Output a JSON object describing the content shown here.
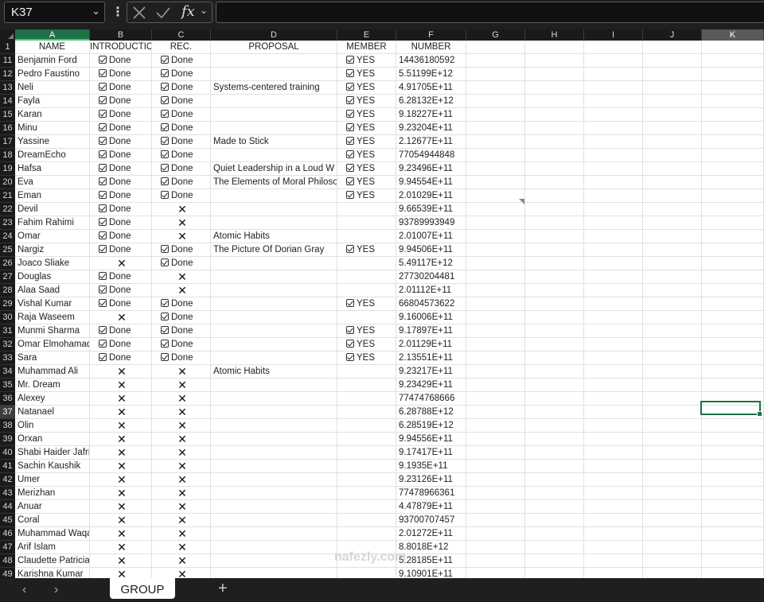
{
  "namebox": {
    "value": "K37"
  },
  "formula": {
    "fx_label": "fx",
    "content": ""
  },
  "columns": [
    {
      "letter": "A",
      "header": "NAME"
    },
    {
      "letter": "B",
      "header": "INTRODUCTION"
    },
    {
      "letter": "C",
      "header": "REC."
    },
    {
      "letter": "D",
      "header": "PROPOSAL"
    },
    {
      "letter": "E",
      "header": "MEMBER"
    },
    {
      "letter": "F",
      "header": "NUMBER"
    },
    {
      "letter": "G",
      "header": ""
    },
    {
      "letter": "H",
      "header": ""
    },
    {
      "letter": "I",
      "header": ""
    },
    {
      "letter": "J",
      "header": ""
    },
    {
      "letter": "K",
      "header": ""
    }
  ],
  "header_row_number": "1",
  "rows": [
    {
      "num": "11",
      "name": "Benjamin Ford",
      "intro": "done",
      "rec": "done",
      "proposal": "",
      "member": "YES",
      "number": "14436180592"
    },
    {
      "num": "12",
      "name": "Pedro Faustino",
      "intro": "done",
      "rec": "done",
      "proposal": "",
      "member": "YES",
      "number": "5.51199E+12"
    },
    {
      "num": "13",
      "name": "Neli",
      "intro": "done",
      "rec": "done",
      "proposal": "Systems-centered training",
      "member": "YES",
      "number": "4.91705E+11"
    },
    {
      "num": "14",
      "name": "Fayla",
      "intro": "done",
      "rec": "done",
      "proposal": "",
      "member": "YES",
      "number": "6.28132E+12"
    },
    {
      "num": "15",
      "name": "Karan",
      "intro": "done",
      "rec": "done",
      "proposal": "",
      "member": "YES",
      "number": "9.18227E+11"
    },
    {
      "num": "16",
      "name": "Minu",
      "intro": "done",
      "rec": "done",
      "proposal": "",
      "member": "YES",
      "number": "9.23204E+11"
    },
    {
      "num": "17",
      "name": "Yassine",
      "intro": "done",
      "rec": "done",
      "proposal": "Made to Stick",
      "member": "YES",
      "number": "2.12677E+11"
    },
    {
      "num": "18",
      "name": "DreamEcho",
      "intro": "done",
      "rec": "done",
      "proposal": "",
      "member": "YES",
      "number": "77054944848"
    },
    {
      "num": "19",
      "name": "Hafsa",
      "intro": "done",
      "rec": "done",
      "proposal": "Quiet Leadership in a Loud W",
      "member": "YES",
      "number": "9.23496E+11"
    },
    {
      "num": "20",
      "name": "Eva",
      "intro": "done",
      "rec": "done",
      "proposal": "The Elements of Moral Philoso",
      "member": "YES",
      "number": "9.94554E+11"
    },
    {
      "num": "21",
      "name": "Eman",
      "intro": "done",
      "rec": "done",
      "proposal": "",
      "member": "YES",
      "number": "2.01029E+11"
    },
    {
      "num": "22",
      "name": "Devil",
      "intro": "done",
      "rec": "x",
      "proposal": "",
      "member": "",
      "number": "9.66539E+11"
    },
    {
      "num": "23",
      "name": "Fahim Rahimi",
      "intro": "done",
      "rec": "x",
      "proposal": "",
      "member": "",
      "number": "93789993949"
    },
    {
      "num": "24",
      "name": "Omar",
      "intro": "done",
      "rec": "x",
      "proposal": "Atomic Habits",
      "member": "",
      "number": "2.01007E+11"
    },
    {
      "num": "25",
      "name": "Nargiz",
      "intro": "done",
      "rec": "done",
      "proposal": "The Picture Of Dorian Gray",
      "member": "YES",
      "number": "9.94506E+11"
    },
    {
      "num": "26",
      "name": "Joaco Sliake",
      "intro": "x",
      "rec": "done",
      "proposal": "",
      "member": "",
      "number": "5.49117E+12"
    },
    {
      "num": "27",
      "name": "Douglas",
      "intro": "done",
      "rec": "x",
      "proposal": "",
      "member": "",
      "number": "27730204481"
    },
    {
      "num": "28",
      "name": "Alaa Saad",
      "intro": "done",
      "rec": "x",
      "proposal": "",
      "member": "",
      "number": "2.01112E+11"
    },
    {
      "num": "29",
      "name": "Vishal Kumar",
      "intro": "done",
      "rec": "done",
      "proposal": "",
      "member": "YES",
      "number": "66804573622"
    },
    {
      "num": "30",
      "name": "Raja Waseem",
      "intro": "x",
      "rec": "done",
      "proposal": "",
      "member": "",
      "number": "9.16006E+11"
    },
    {
      "num": "31",
      "name": "Munmi Sharma",
      "intro": "done",
      "rec": "done",
      "proposal": "",
      "member": "YES",
      "number": "9.17897E+11"
    },
    {
      "num": "32",
      "name": "Omar Elmohamady",
      "intro": "done",
      "rec": "done",
      "proposal": "",
      "member": "YES",
      "number": "2.01129E+11"
    },
    {
      "num": "33",
      "name": "Sara",
      "intro": "done",
      "rec": "done",
      "proposal": "",
      "member": "YES",
      "number": "2.13551E+11"
    },
    {
      "num": "34",
      "name": "Muhammad Ali",
      "intro": "x",
      "rec": "x",
      "proposal": "Atomic Habits",
      "member": "",
      "number": "9.23217E+11"
    },
    {
      "num": "35",
      "name": "Mr. Dream",
      "intro": "x",
      "rec": "x",
      "proposal": "",
      "member": "",
      "number": "9.23429E+11"
    },
    {
      "num": "36",
      "name": "Alexey",
      "intro": "x",
      "rec": "x",
      "proposal": "",
      "member": "",
      "number": "77474768666"
    },
    {
      "num": "37",
      "name": "Natanael",
      "intro": "x",
      "rec": "x",
      "proposal": "",
      "member": "",
      "number": "6.28788E+12"
    },
    {
      "num": "38",
      "name": "Olin",
      "intro": "x",
      "rec": "x",
      "proposal": "",
      "member": "",
      "number": "6.28519E+12"
    },
    {
      "num": "39",
      "name": "Orxan",
      "intro": "x",
      "rec": "x",
      "proposal": "",
      "member": "",
      "number": "9.94556E+11"
    },
    {
      "num": "40",
      "name": "Shabi Haider Jafri",
      "intro": "x",
      "rec": "x",
      "proposal": "",
      "member": "",
      "number": "9.17417E+11"
    },
    {
      "num": "41",
      "name": "Sachin Kaushik",
      "intro": "x",
      "rec": "x",
      "proposal": "",
      "member": "",
      "number": "9.1935E+11"
    },
    {
      "num": "42",
      "name": "Umer",
      "intro": "x",
      "rec": "x",
      "proposal": "",
      "member": "",
      "number": "9.23126E+11"
    },
    {
      "num": "43",
      "name": "Merizhan",
      "intro": "x",
      "rec": "x",
      "proposal": "",
      "member": "",
      "number": "77478966361"
    },
    {
      "num": "44",
      "name": "Anuar",
      "intro": "x",
      "rec": "x",
      "proposal": "",
      "member": "",
      "number": "4.47879E+11"
    },
    {
      "num": "45",
      "name": "Coral",
      "intro": "x",
      "rec": "x",
      "proposal": "",
      "member": "",
      "number": "93700707457"
    },
    {
      "num": "46",
      "name": "Muhammad Waqas",
      "intro": "x",
      "rec": "x",
      "proposal": "",
      "member": "",
      "number": "2.01272E+11"
    },
    {
      "num": "47",
      "name": "Arif Islam",
      "intro": "x",
      "rec": "x",
      "proposal": "",
      "member": "",
      "number": "8.8018E+12"
    },
    {
      "num": "48",
      "name": "Claudette Patricia",
      "intro": "x",
      "rec": "x",
      "proposal": "",
      "member": "",
      "number": "5.28185E+11"
    },
    {
      "num": "49",
      "name": "Karishna Kumar",
      "intro": "x",
      "rec": "x",
      "proposal": "",
      "member": "",
      "number": "9.10901E+11"
    }
  ],
  "done_label": "Done",
  "sheet_tab": {
    "name": "GROUP"
  },
  "watermark": "nafezly.com",
  "colors": {
    "accent": "#1e7145",
    "chrome": "#1f1f1f"
  }
}
